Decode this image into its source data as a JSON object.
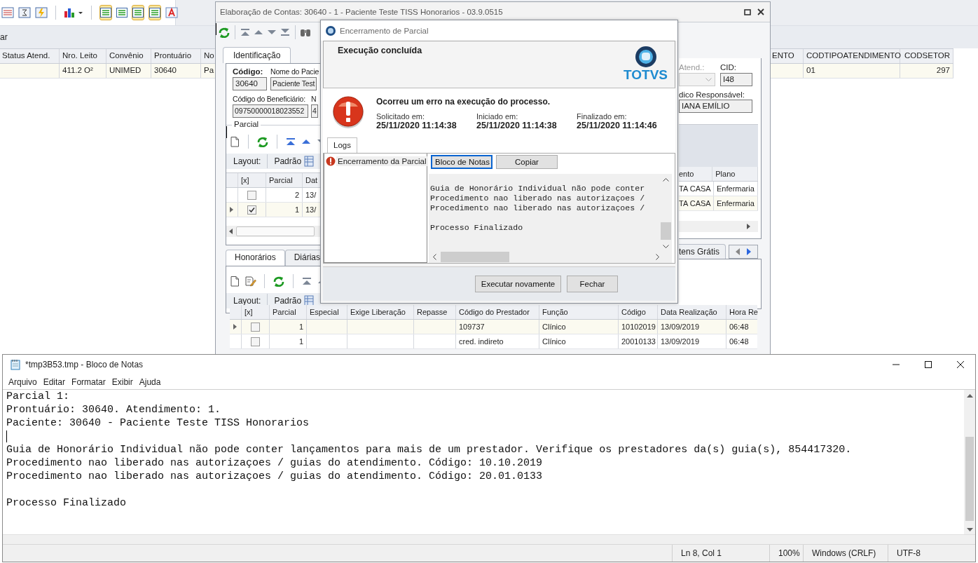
{
  "background_app": {
    "filter_label": "ar",
    "columns_left": [
      {
        "label": "Status Atend."
      },
      {
        "label": "Nro. Leito",
        "cell": "411.2 O²"
      },
      {
        "label": "Convênio",
        "cell": "UNIMED"
      },
      {
        "label": "Prontuário",
        "cell": "30640"
      },
      {
        "label": "No",
        "cell": "Pa"
      }
    ],
    "columns_right": [
      {
        "label": "ENTO"
      },
      {
        "label": "CODTIPOATENDIMENTO",
        "cell": "01"
      },
      {
        "label": "CODSETOR",
        "cell": "297"
      }
    ]
  },
  "main_window": {
    "title": "Elaboração de Contas: 30640 - 1 - Paciente Teste TISS Honorarios - 03.9.0515",
    "tabs": [
      {
        "label": "Identificação",
        "selected": true
      }
    ],
    "fields_row_1": [
      {
        "label": "Código:",
        "value": "30640",
        "emphasis": true
      },
      {
        "label": "Nome do Pacie",
        "value": "Paciente Test",
        "emphasis": false
      }
    ],
    "fields_row_2": [
      {
        "label": "Código do Beneficiário:",
        "value": "09750000018023552",
        "emphasis": false
      },
      {
        "label": "N",
        "value": "4",
        "emphasis": false
      }
    ],
    "right_fields": {
      "atend_label": "Atend.:",
      "cid_label": "CID:",
      "cid_value": "I48",
      "medico_label": "dico Responsável:",
      "medico_value": "IANA EMÍLIO"
    },
    "parcial": {
      "legend": "Parcial",
      "layout_label": "Layout:",
      "layout_value": "Padrão",
      "columns": [
        "[x]",
        "Parcial",
        "Dat"
      ],
      "rows": [
        {
          "current": false,
          "checked": false,
          "parcial": "2",
          "data": "13/"
        },
        {
          "current": true,
          "checked": true,
          "parcial": "1",
          "data": "13/"
        }
      ],
      "right_columns": [
        "ento",
        "Plano"
      ],
      "right_rows": [
        [
          "TA CASA",
          "Enfermaria"
        ],
        [
          "TA CASA",
          "Enfermaria"
        ]
      ]
    },
    "lower_tabs": [
      {
        "label": "Honorários",
        "selected": true
      },
      {
        "label": "Diárias",
        "selected": false
      }
    ],
    "lower_tabs_right": [
      {
        "label": "tens Grátis",
        "selected": false
      }
    ],
    "honorarios": {
      "layout_label": "Layout:",
      "layout_value": "Padrão",
      "columns": [
        "[x]",
        "Parcial",
        "Especial",
        "Exige Liberação",
        "Repasse",
        "Código do Prestador",
        "Função",
        "Código",
        "Data Realização",
        "Hora Re"
      ],
      "rows": [
        {
          "current": true,
          "checked": false,
          "parcial": "1",
          "prestador": "109737",
          "funcao": "Clínico",
          "codigo": "10102019",
          "data": "13/09/2019",
          "hora": "06:48"
        },
        {
          "current": false,
          "checked": false,
          "parcial": "1",
          "prestador": "cred. indireto",
          "funcao": "Clínico",
          "codigo": "20010133",
          "data": "13/09/2019",
          "hora": "06:48"
        }
      ]
    }
  },
  "dialog": {
    "title": "Encerramento de Parcial",
    "heading": "Execução concluída",
    "logo": "TOTVS",
    "message": "Ocorreu um erro na execução do processo.",
    "times": [
      {
        "label": "Solicitado em:",
        "value": "25/11/2020 11:14:38"
      },
      {
        "label": "Iniciado em:",
        "value": "25/11/2020 11:14:38"
      },
      {
        "label": "Finalizado em:",
        "value": "25/11/2020 11:14:46"
      }
    ],
    "tabs": [
      {
        "label": "Logs",
        "selected": true
      }
    ],
    "log_items": [
      {
        "label": "Encerramento da Parcial",
        "selected": true
      }
    ],
    "log_buttons": [
      {
        "label": "Bloco de Notas",
        "focused": true
      },
      {
        "label": "Copiar",
        "focused": false
      }
    ],
    "log_blocks": [
      [
        "Guia de Honorário Individual não pode conter",
        "Procedimento nao liberado nas autorizaçoes /",
        "Procedimento nao liberado nas autorizaçoes /"
      ],
      [
        "Processo Finalizado"
      ]
    ],
    "buttons": [
      "Executar novamente",
      "Fechar"
    ]
  },
  "notepad": {
    "title": "*tmp3B53.tmp - Bloco de Notas",
    "menu": [
      "Arquivo",
      "Editar",
      "Formatar",
      "Exibir",
      "Ajuda"
    ],
    "blocks": [
      [
        "Parcial 1:",
        "Prontuário: 30640. Atendimento: 1.",
        "Paciente: 30640 - Paciente Teste TISS Honorarios"
      ],
      [
        "Guia de Honorário Individual não pode conter lançamentos para mais de um prestador. Verifique os prestadores da(s) guia(s), 854417320.",
        "Procedimento nao liberado nas autorizaçoes / guias do atendimento. Código: 10.10.2019",
        "Procedimento nao liberado nas autorizaçoes / guias do atendimento. Código: 20.01.0133"
      ],
      [
        "Processo Finalizado"
      ]
    ],
    "status": [
      "Ln 8, Col 1",
      "100%",
      "Windows (CRLF)",
      "UTF-8"
    ]
  }
}
